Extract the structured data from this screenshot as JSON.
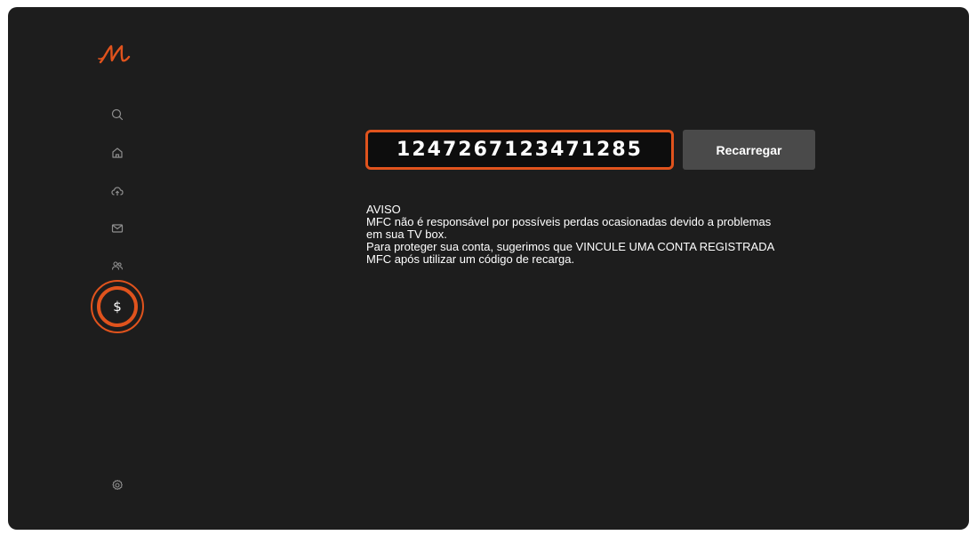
{
  "app": {
    "brand_color": "#e0531d",
    "background_color": "#1d1d1d"
  },
  "sidebar": {
    "items": [
      {
        "icon": "search-icon",
        "label": ""
      },
      {
        "icon": "home-icon",
        "label": ""
      },
      {
        "icon": "cloud-upload-icon",
        "label": ""
      },
      {
        "icon": "mail-icon",
        "label": ""
      },
      {
        "icon": "users-icon",
        "label": ""
      },
      {
        "icon": "dollar-icon",
        "symbol": "$",
        "active": true
      },
      {
        "icon": "settings-icon",
        "label": ""
      }
    ]
  },
  "recharge": {
    "code_value": "1247267123471285",
    "button_label": "Recarregar"
  },
  "notice": {
    "title": "AVISO",
    "lines": [
      "MFC não é responsável por possíveis perdas ocasionadas devido a problemas",
      "em sua TV box.",
      "Para proteger sua conta, sugerimos que VINCULE UMA CONTA REGISTRADA",
      "MFC após utilizar um código de recarga."
    ]
  }
}
